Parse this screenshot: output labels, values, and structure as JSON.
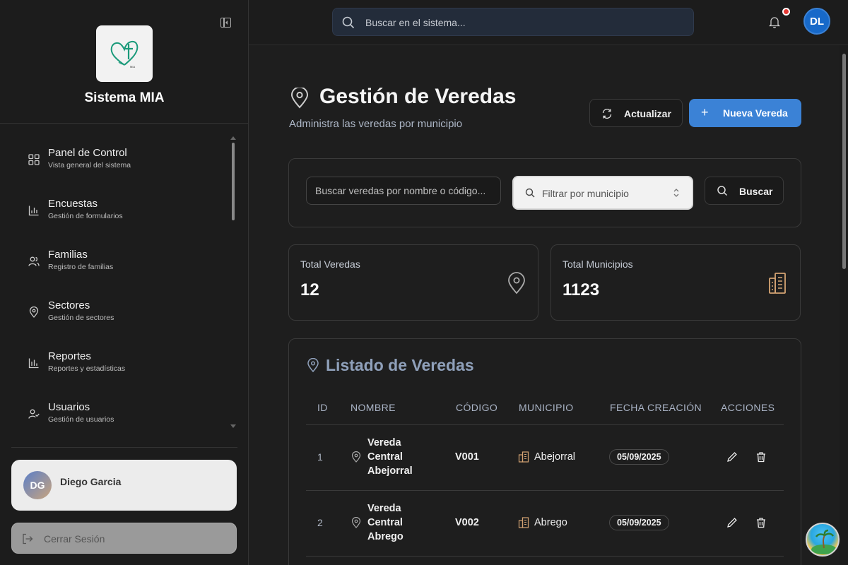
{
  "sidebar": {
    "app_name": "Sistema MIA",
    "logo_text": "MIA",
    "items": [
      {
        "label": "Panel de Control",
        "sub": "Vista general del sistema",
        "icon": "grid-icon"
      },
      {
        "label": "Encuestas",
        "sub": "Gestión de formularios",
        "icon": "bar-chart-icon"
      },
      {
        "label": "Familias",
        "sub": "Registro de familias",
        "icon": "users-icon"
      },
      {
        "label": "Sectores",
        "sub": "Gestión de sectores",
        "icon": "map-pin-icon"
      },
      {
        "label": "Reportes",
        "sub": "Reportes y estadísticas",
        "icon": "bar-chart-icon"
      },
      {
        "label": "Usuarios",
        "sub": "Gestión de usuarios",
        "icon": "user-check-icon"
      }
    ],
    "user": {
      "initials": "DG",
      "name": "Diego Garcia"
    },
    "logout_label": "Cerrar Sesión"
  },
  "topbar": {
    "search_placeholder": "Buscar en el sistema...",
    "avatar_initials": "DL"
  },
  "page": {
    "title": "Gestión de Veredas",
    "subtitle": "Administra las veredas por municipio",
    "refresh_label": "Actualizar",
    "new_label": "Nueva Vereda",
    "new_plus": "+"
  },
  "filters": {
    "search_placeholder": "Buscar veredas por nombre o código...",
    "municipio_placeholder": "Filtrar por municipio",
    "search_button": "Buscar"
  },
  "stats": {
    "total_veredas_label": "Total Veredas",
    "total_veredas_value": "12",
    "total_municipios_label": "Total Municipios",
    "total_municipios_value": "1123"
  },
  "list": {
    "title": "Listado de Veredas",
    "columns": [
      "ID",
      "NOMBRE",
      "CÓDIGO",
      "MUNICIPIO",
      "FECHA CREACIÓN",
      "ACCIONES"
    ],
    "rows": [
      {
        "id": "1",
        "nombre": "Vereda Central Abejorral",
        "codigo": "V001",
        "municipio": "Abejorral",
        "fecha": "05/09/2025"
      },
      {
        "id": "2",
        "nombre": "Vereda Central Abrego",
        "codigo": "V002",
        "municipio": "Abrego",
        "fecha": "05/09/2025"
      }
    ]
  },
  "colors": {
    "accent": "#3b82d6",
    "municipio_icon": "#d4a373",
    "notification_dot": "#e53935"
  }
}
